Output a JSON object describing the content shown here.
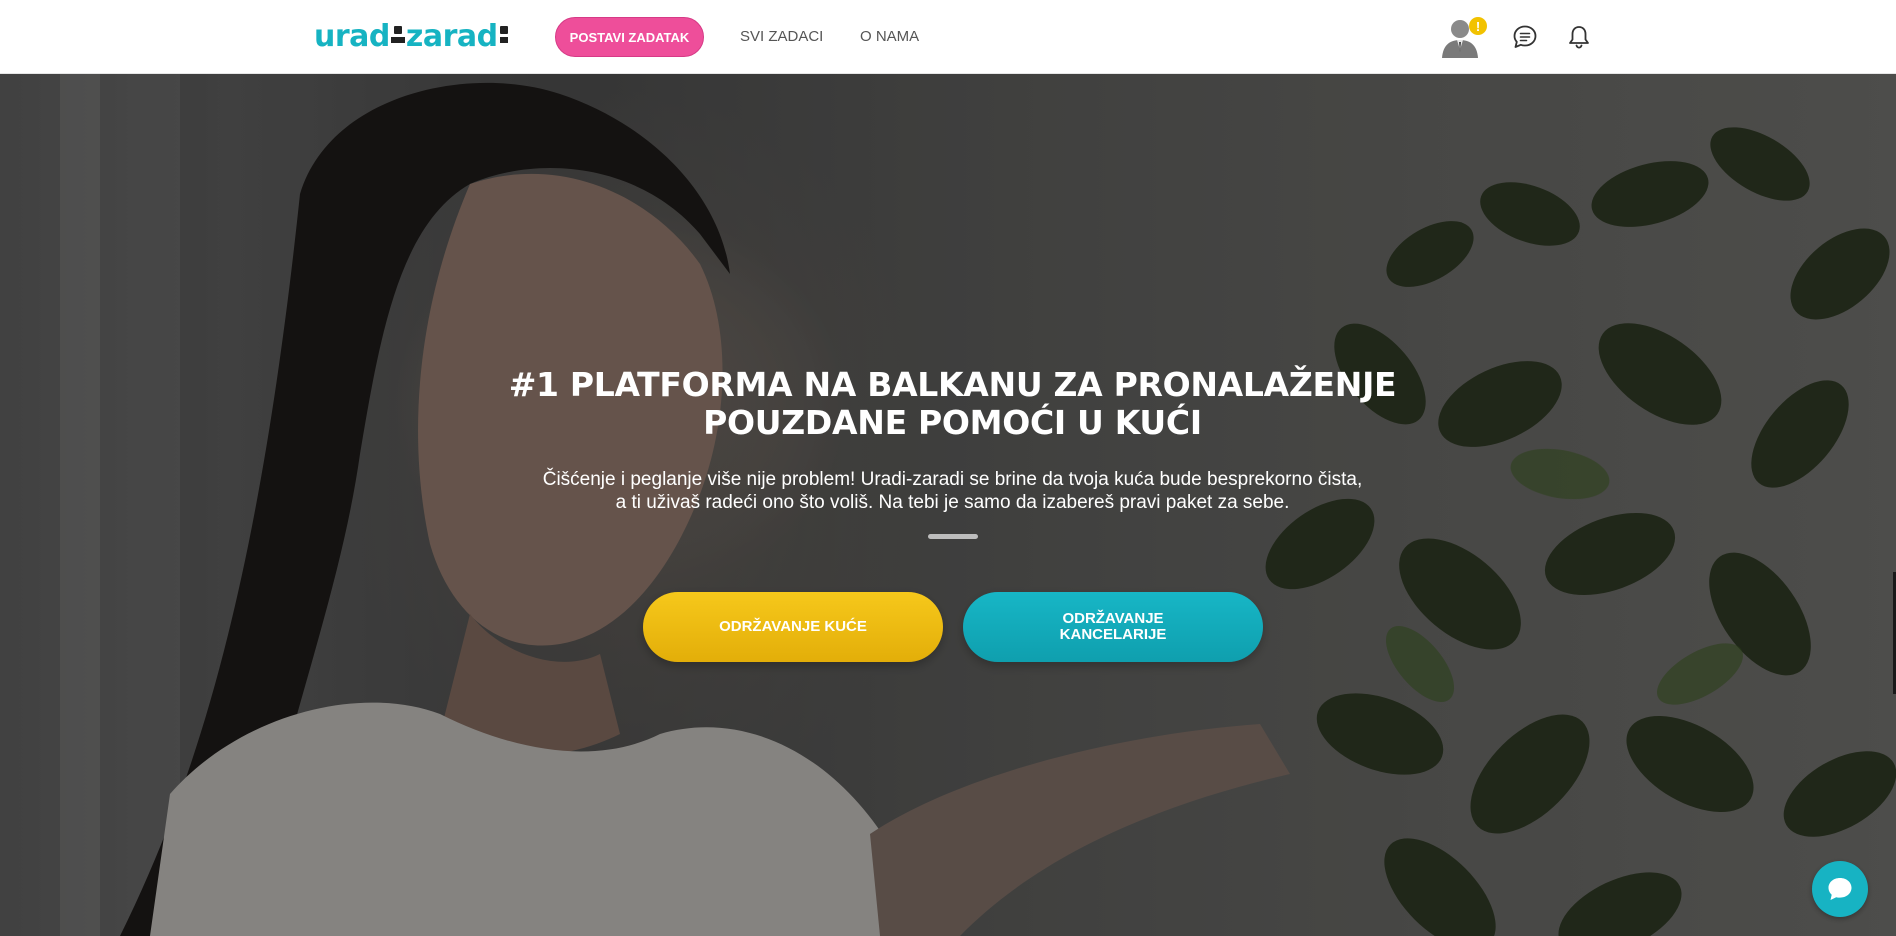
{
  "navbar": {
    "logo": {
      "part1": "urad",
      "part2": "zarad"
    },
    "post_task_label": "POSTAVI ZADATAK",
    "links": [
      "SVI ZADACI",
      "O NAMA"
    ],
    "avatar_badge": "!",
    "icons": [
      "user-avatar-icon",
      "chat-icon",
      "bell-icon"
    ]
  },
  "hero": {
    "headline_line1": "#1 PLATFORMA NA BALKANU ZA PRONALAŽENJE",
    "headline_line2": "POUZDANE POMOĆI U KUĆI",
    "sub_line1": "Čišćenje i peglanje više nije problem! Uradi-zaradi se brine da tvoja kuća bude besprekorno čista,",
    "sub_line2": "a ti uživaš radeći ono što voliš. Na tebi je samo da izabereš pravi paket za sebe.",
    "cta_home": "ODRŽAVANJE KUĆE",
    "cta_office_line1": "ODRŽAVANJE",
    "cta_office_line2": "KANCELARIJE"
  },
  "colors": {
    "brand_teal": "#16b3c2",
    "brand_pink": "#ee4e9a",
    "brand_yellow": "#f2c200"
  }
}
